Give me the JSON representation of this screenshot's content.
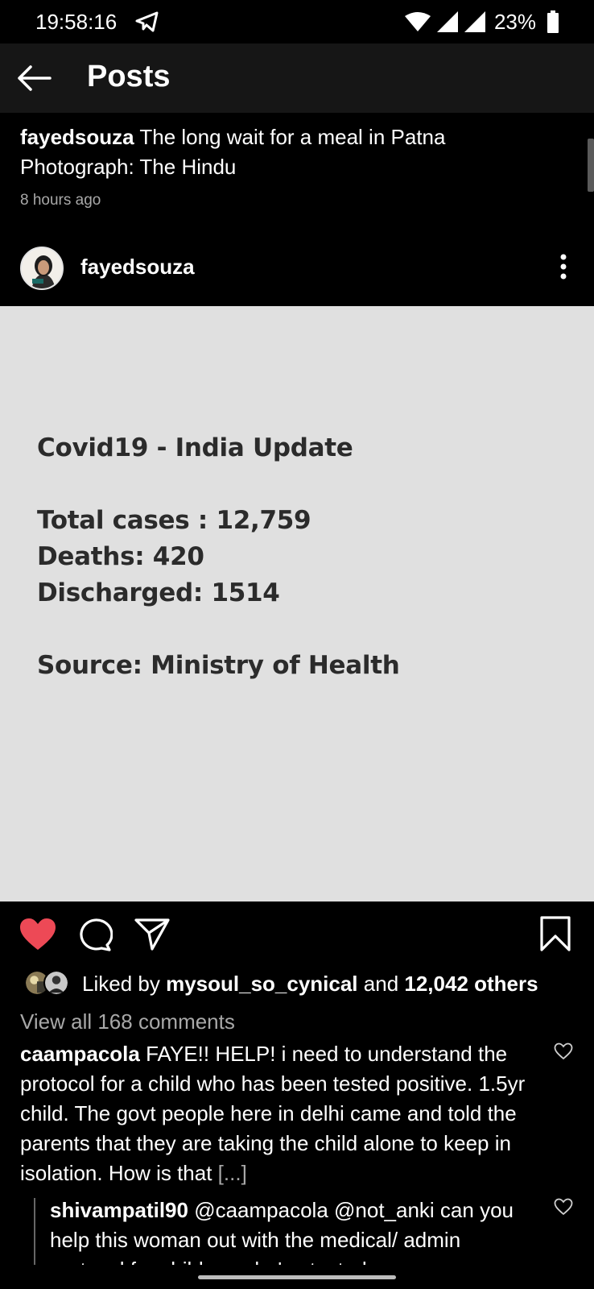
{
  "status_bar": {
    "time": "19:58:16",
    "battery": "23%"
  },
  "app_bar": {
    "title": "Posts"
  },
  "previous_post": {
    "username": "fayedsouza",
    "caption_line1": " The long wait for a meal in Patna",
    "caption_line2": "Photograph: The Hindu",
    "time_ago": "8 hours ago"
  },
  "post": {
    "username": "fayedsouza",
    "image_lines": [
      "Covid19 - India Update",
      "Total cases : 12,759",
      "Deaths: 420",
      "Discharged: 1514",
      "Source: Ministry of Health"
    ],
    "liked_by_prefix": "Liked by ",
    "liked_by_user": "mysoul_so_cynical",
    "liked_by_mid": " and ",
    "liked_by_count": "12,042 others",
    "view_all": "View all 168 comments",
    "liked": true
  },
  "comments": [
    {
      "username": "caampacola",
      "text": " FAYE!! HELP! i need to understand the protocol for a child who has been tested positive. 1.5yr child. The govt people here in delhi came and told the parents that they are taking the child alone to keep in isolation. How is that ",
      "more": "[...]"
    }
  ],
  "replies": [
    {
      "username": "shivampatil90",
      "text": " @caampacola @not_anki can you help this woman out with the medical/ admin protocol for children who've tested"
    }
  ],
  "colors": {
    "like_red": "#ed4956",
    "post_bg": "#e0e0e0",
    "muted": "#a8a8a8"
  }
}
